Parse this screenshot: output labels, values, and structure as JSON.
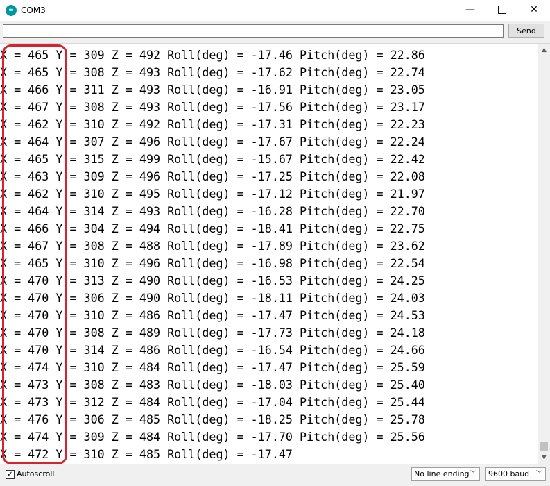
{
  "window": {
    "title": "COM3",
    "app_icon_glyph": "∞",
    "minimize_glyph": "—",
    "close_glyph": "✕"
  },
  "send_bar": {
    "input_value": "",
    "send_label": "Send"
  },
  "serial_output": {
    "lines": [
      "X = 465 Y = 309 Z = 492 Roll(deg) = -17.46 Pitch(deg) = 22.86",
      "X = 465 Y = 308 Z = 493 Roll(deg) = -17.62 Pitch(deg) = 22.74",
      "X = 466 Y = 311 Z = 493 Roll(deg) = -16.91 Pitch(deg) = 23.05",
      "X = 467 Y = 308 Z = 493 Roll(deg) = -17.56 Pitch(deg) = 23.17",
      "X = 462 Y = 310 Z = 492 Roll(deg) = -17.31 Pitch(deg) = 22.23",
      "X = 464 Y = 307 Z = 496 Roll(deg) = -17.67 Pitch(deg) = 22.24",
      "X = 465 Y = 315 Z = 499 Roll(deg) = -15.67 Pitch(deg) = 22.42",
      "X = 463 Y = 309 Z = 496 Roll(deg) = -17.25 Pitch(deg) = 22.08",
      "X = 462 Y = 310 Z = 495 Roll(deg) = -17.12 Pitch(deg) = 21.97",
      "X = 464 Y = 314 Z = 493 Roll(deg) = -16.28 Pitch(deg) = 22.70",
      "X = 466 Y = 304 Z = 494 Roll(deg) = -18.41 Pitch(deg) = 22.75",
      "X = 467 Y = 308 Z = 488 Roll(deg) = -17.89 Pitch(deg) = 23.62",
      "X = 465 Y = 310 Z = 496 Roll(deg) = -16.98 Pitch(deg) = 22.54",
      "X = 470 Y = 313 Z = 490 Roll(deg) = -16.53 Pitch(deg) = 24.25",
      "X = 470 Y = 306 Z = 490 Roll(deg) = -18.11 Pitch(deg) = 24.03",
      "X = 470 Y = 310 Z = 486 Roll(deg) = -17.47 Pitch(deg) = 24.53",
      "X = 470 Y = 308 Z = 489 Roll(deg) = -17.73 Pitch(deg) = 24.18",
      "X = 470 Y = 314 Z = 486 Roll(deg) = -16.54 Pitch(deg) = 24.66",
      "X = 474 Y = 310 Z = 484 Roll(deg) = -17.47 Pitch(deg) = 25.59",
      "X = 473 Y = 308 Z = 483 Roll(deg) = -18.03 Pitch(deg) = 25.40",
      "X = 473 Y = 312 Z = 484 Roll(deg) = -17.04 Pitch(deg) = 25.44",
      "X = 476 Y = 306 Z = 485 Roll(deg) = -18.25 Pitch(deg) = 25.78",
      "X = 474 Y = 309 Z = 484 Roll(deg) = -17.70 Pitch(deg) = 25.56",
      "X = 472 Y = 310 Z = 485 Roll(deg) = -17.47"
    ],
    "highlight_color": "#d6242f"
  },
  "footer": {
    "autoscroll_checked": true,
    "autoscroll_label": "Autoscroll",
    "line_ending": "No line ending",
    "baud_rate": "9600 baud"
  }
}
